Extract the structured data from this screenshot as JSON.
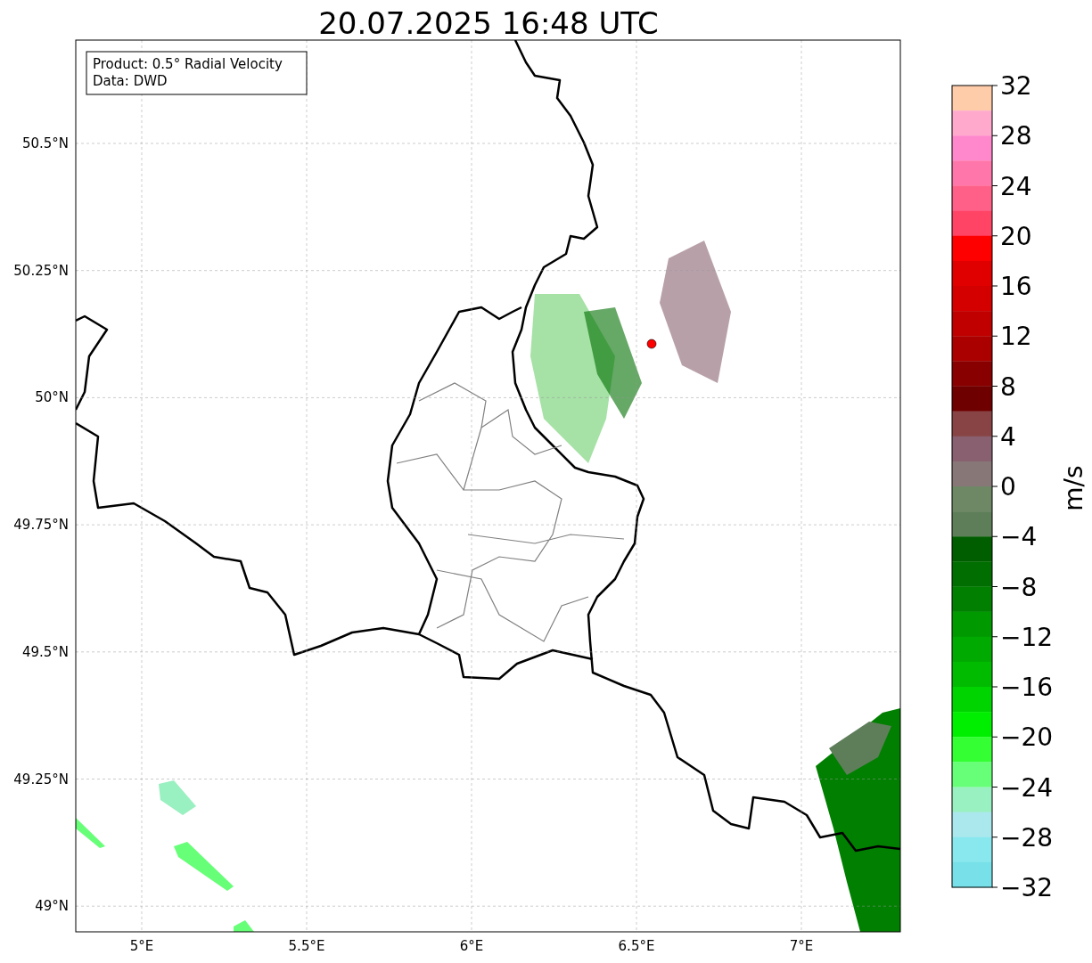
{
  "title": "20.07.2025 16:48 UTC",
  "info_box": {
    "lines": [
      "Product: 0.5° Radial Velocity",
      "Data: DWD"
    ]
  },
  "map": {
    "latitude_labels": [
      "50.5°N",
      "50.25°N",
      "50°N",
      "49.75°N",
      "49.5°N",
      "49.25°N",
      "49°N"
    ],
    "longitude_labels": [
      "5°E",
      "5.5°E",
      "6°E",
      "6.5°E",
      "7°E"
    ]
  },
  "colorbar": {
    "label": "m/s",
    "ticks": [
      "32",
      "28",
      "24",
      "20",
      "16",
      "12",
      "8",
      "4",
      "0",
      "−4",
      "−8",
      "−12",
      "−16",
      "−20",
      "−24",
      "−28",
      "−32"
    ],
    "bands": [
      {
        "color": "#ffccaa"
      },
      {
        "color": "#ffaacc"
      },
      {
        "color": "#ff88cc"
      },
      {
        "color": "#ff77aa"
      },
      {
        "color": "#ff6088"
      },
      {
        "color": "#ff4466"
      },
      {
        "color": "#ff0000"
      },
      {
        "color": "#e00000"
      },
      {
        "color": "#d40000"
      },
      {
        "color": "#c00000"
      },
      {
        "color": "#aa0000"
      },
      {
        "color": "#880000"
      },
      {
        "color": "#6e0000"
      },
      {
        "color": "#884444"
      },
      {
        "color": "#886070"
      },
      {
        "color": "#887777"
      },
      {
        "color": "#6e8866"
      },
      {
        "color": "#5e7e5a"
      },
      {
        "color": "#005e00"
      },
      {
        "color": "#006e00"
      },
      {
        "color": "#007f00"
      },
      {
        "color": "#009900"
      },
      {
        "color": "#00aa00"
      },
      {
        "color": "#00bb00"
      },
      {
        "color": "#00d400"
      },
      {
        "color": "#00ee00"
      },
      {
        "color": "#33ff33"
      },
      {
        "color": "#66ff77"
      },
      {
        "color": "#99f0c0"
      },
      {
        "color": "#aae8ee"
      },
      {
        "color": "#88e8ee"
      },
      {
        "color": "#77e0e8"
      }
    ]
  }
}
